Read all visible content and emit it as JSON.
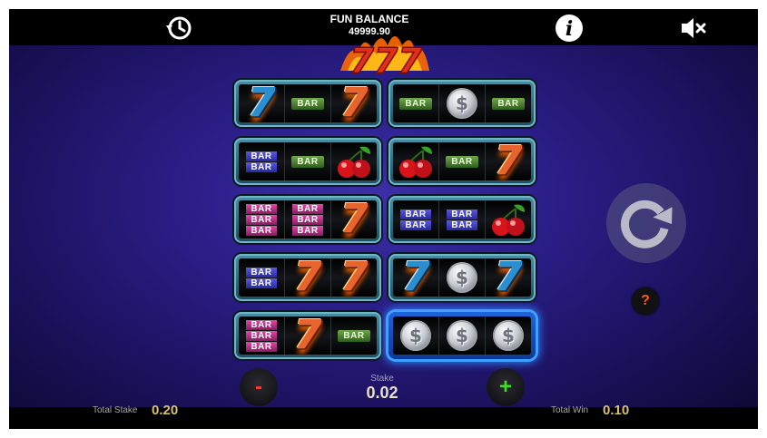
{
  "header": {
    "balance_label": "FUN BALANCE",
    "balance_value": "49999.90",
    "history_icon": "history-clock-icon",
    "info_icon": "info-icon",
    "mute_icon": "speaker-muted-icon"
  },
  "game": {
    "logo_symbol": "777"
  },
  "reel_sets": [
    {
      "win": false,
      "symbols": [
        {
          "type": "seven",
          "variant": "blue",
          "label": "7"
        },
        {
          "type": "bar1",
          "label": "BAR"
        },
        {
          "type": "seven",
          "variant": "orange",
          "label": "7"
        }
      ]
    },
    {
      "win": false,
      "symbols": [
        {
          "type": "bar1",
          "label": "BAR"
        },
        {
          "type": "coin",
          "label": "$"
        },
        {
          "type": "bar1",
          "label": "BAR"
        }
      ]
    },
    {
      "win": false,
      "symbols": [
        {
          "type": "bar2",
          "label": "BAR"
        },
        {
          "type": "bar1",
          "label": "BAR"
        },
        {
          "type": "cherry",
          "label": ""
        }
      ]
    },
    {
      "win": false,
      "symbols": [
        {
          "type": "cherry",
          "label": ""
        },
        {
          "type": "bar1",
          "label": "BAR"
        },
        {
          "type": "seven",
          "variant": "orange",
          "label": "7"
        }
      ]
    },
    {
      "win": false,
      "symbols": [
        {
          "type": "bar3",
          "label": "BAR"
        },
        {
          "type": "bar3",
          "label": "BAR"
        },
        {
          "type": "seven",
          "variant": "orange",
          "label": "7"
        }
      ]
    },
    {
      "win": false,
      "symbols": [
        {
          "type": "bar2",
          "label": "BAR"
        },
        {
          "type": "bar2",
          "label": "BAR"
        },
        {
          "type": "cherry",
          "label": ""
        }
      ]
    },
    {
      "win": false,
      "symbols": [
        {
          "type": "bar2",
          "label": "BAR"
        },
        {
          "type": "seven",
          "variant": "orange",
          "label": "7"
        },
        {
          "type": "seven",
          "variant": "orange",
          "label": "7"
        }
      ]
    },
    {
      "win": false,
      "symbols": [
        {
          "type": "seven",
          "variant": "blue",
          "label": "7"
        },
        {
          "type": "coin",
          "label": "$"
        },
        {
          "type": "seven",
          "variant": "blue",
          "label": "7"
        }
      ]
    },
    {
      "win": false,
      "symbols": [
        {
          "type": "bar3",
          "label": "BAR"
        },
        {
          "type": "seven",
          "variant": "orange",
          "label": "7"
        },
        {
          "type": "bar1",
          "label": "BAR"
        }
      ]
    },
    {
      "win": true,
      "symbols": [
        {
          "type": "coin",
          "label": "$"
        },
        {
          "type": "coin",
          "label": "$"
        },
        {
          "type": "coin",
          "label": "$"
        }
      ]
    }
  ],
  "controls": {
    "stake_label": "Stake",
    "stake_value": "0.02",
    "minus_label": "-",
    "plus_label": "+",
    "help_label": "?",
    "spin_icon": "spin-arrow-icon"
  },
  "footer": {
    "total_stake_label": "Total Stake",
    "total_stake_value": "0.20",
    "total_win_label": "Total Win",
    "total_win_value": "0.10"
  },
  "colors": {
    "background": "#2a1d86",
    "win_glow": "#3fa0ff",
    "minus": "#ff3a2a",
    "plus": "#3fe020",
    "value_gold": "#d8c070"
  }
}
